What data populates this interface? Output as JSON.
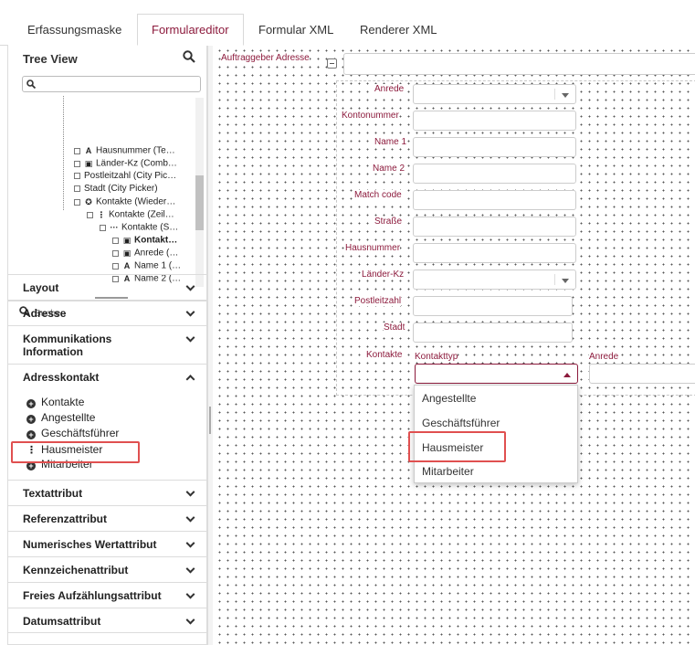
{
  "tabs": [
    {
      "label": "Erfassungsmaske",
      "active": false
    },
    {
      "label": "Formulareditor",
      "active": true
    },
    {
      "label": "Formular XML",
      "active": false
    },
    {
      "label": "Renderer XML",
      "active": false
    }
  ],
  "left_panel": {
    "tree_view_title": "Tree View",
    "search_placeholder": "Suchen",
    "tree_items": [
      {
        "label": "Hausnummer (Te…",
        "icon": "text-attribute-icon"
      },
      {
        "label": "Länder-Kz (Comb…",
        "icon": "combobox-icon"
      },
      {
        "label": "Postleitzahl (City Pic…",
        "icon": "none"
      },
      {
        "label": "Stadt (City Picker)",
        "icon": "none"
      },
      {
        "label": "Kontakte (Wieder…",
        "icon": "repeat-icon"
      },
      {
        "label": "Kontakte (Zeil…",
        "icon": "vertical-dots-icon"
      },
      {
        "label": "Kontakte (S…",
        "icon": "horizontal-dots-icon"
      },
      {
        "label": "Kontakt…",
        "icon": "combobox-icon"
      },
      {
        "label": "Anrede (…",
        "icon": "combobox-icon"
      },
      {
        "label": "Name 1 (…",
        "icon": "text-attribute-icon"
      },
      {
        "label": "Name 2 (…",
        "icon": "text-attribute-icon"
      }
    ],
    "accordion": [
      {
        "label": "Layout",
        "expanded": false
      },
      {
        "label": "Adresse",
        "expanded": false
      },
      {
        "label": "Kommunikations Information",
        "expanded": false
      },
      {
        "label": "Adresskontakt",
        "expanded": true
      },
      {
        "label": "Textattribut",
        "expanded": false
      },
      {
        "label": "Referenzattribut",
        "expanded": false
      },
      {
        "label": "Numerisches Wertattribut",
        "expanded": false
      },
      {
        "label": "Kennzeichenattribut",
        "expanded": false
      },
      {
        "label": "Freies Aufzählungsattribut",
        "expanded": false
      },
      {
        "label": "Datumsattribut",
        "expanded": false
      }
    ],
    "adresskontakt_items": [
      {
        "label": "Kontakte",
        "icon": "plus-circle-icon"
      },
      {
        "label": "Angestellte",
        "icon": "plus-circle-icon"
      },
      {
        "label": "Geschäftsführer",
        "icon": "plus-circle-icon"
      },
      {
        "label": "Hausmeister",
        "icon": "vertical-dots-icon"
      },
      {
        "label": "Mitarbeiter",
        "icon": "plus-circle-icon"
      }
    ]
  },
  "form": {
    "auftraggeber_label": "Auftraggeber Adresse",
    "fields": [
      {
        "label": "Anrede",
        "type": "select"
      },
      {
        "label": "Kontonummer",
        "type": "text"
      },
      {
        "label": "Name 1",
        "type": "text"
      },
      {
        "label": "Name 2",
        "type": "text"
      },
      {
        "label": "Match code",
        "type": "text"
      },
      {
        "label": "Straße",
        "type": "text"
      },
      {
        "label": "Hausnummer",
        "type": "text"
      },
      {
        "label": "Länder-Kz",
        "type": "select"
      },
      {
        "label": "Postleitzahl",
        "type": "text"
      },
      {
        "label": "Stadt",
        "type": "text"
      }
    ],
    "kontakte_label": "Kontakte",
    "kontakttyp_label": "Kontakttyp",
    "anrede_col_label": "Anrede",
    "dropdown_options": [
      "Angestellte",
      "Geschäftsführer",
      "Hausmeister",
      "Mitarbeiter"
    ]
  },
  "colors": {
    "accent": "#8c1a3c",
    "highlight": "#e05050"
  }
}
